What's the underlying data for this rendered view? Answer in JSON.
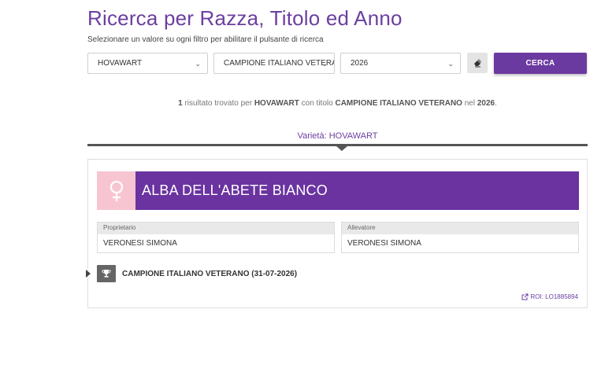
{
  "header": {
    "title": "Ricerca per Razza, Titolo ed Anno",
    "subtitle": "Selezionare un valore su ogni filtro per abilitare il pulsante di ricerca"
  },
  "filters": {
    "breed": "HOVAWART",
    "title": "CAMPIONE ITALIANO VETERANO",
    "year": "2026",
    "search_label": "CERCA",
    "clear_icon": "eraser-icon"
  },
  "result": {
    "count": "1",
    "text1": " risultato trovato per ",
    "breed": "HOVAWART",
    "text2": " con titolo ",
    "title": "CAMPIONE ITALIANO VETERANO",
    "text3": " nel ",
    "year": "2026",
    "text4": "."
  },
  "variety": {
    "label": "Varietà: HOVAWART"
  },
  "dog": {
    "sex_icon": "female-icon",
    "name": "ALBA DELL'ABETE BIANCO",
    "owner_label": "Proprietario",
    "owner": "VERONESI SIMONA",
    "breeder_label": "Allevatore",
    "breeder": "VERONESI SIMONA",
    "award": "CAMPIONE ITALIANO VETERANO (31-07-2026)",
    "roi": "ROI: LO1885894"
  },
  "colors": {
    "accent": "#6a33a0",
    "female": "#f7c5d2"
  }
}
